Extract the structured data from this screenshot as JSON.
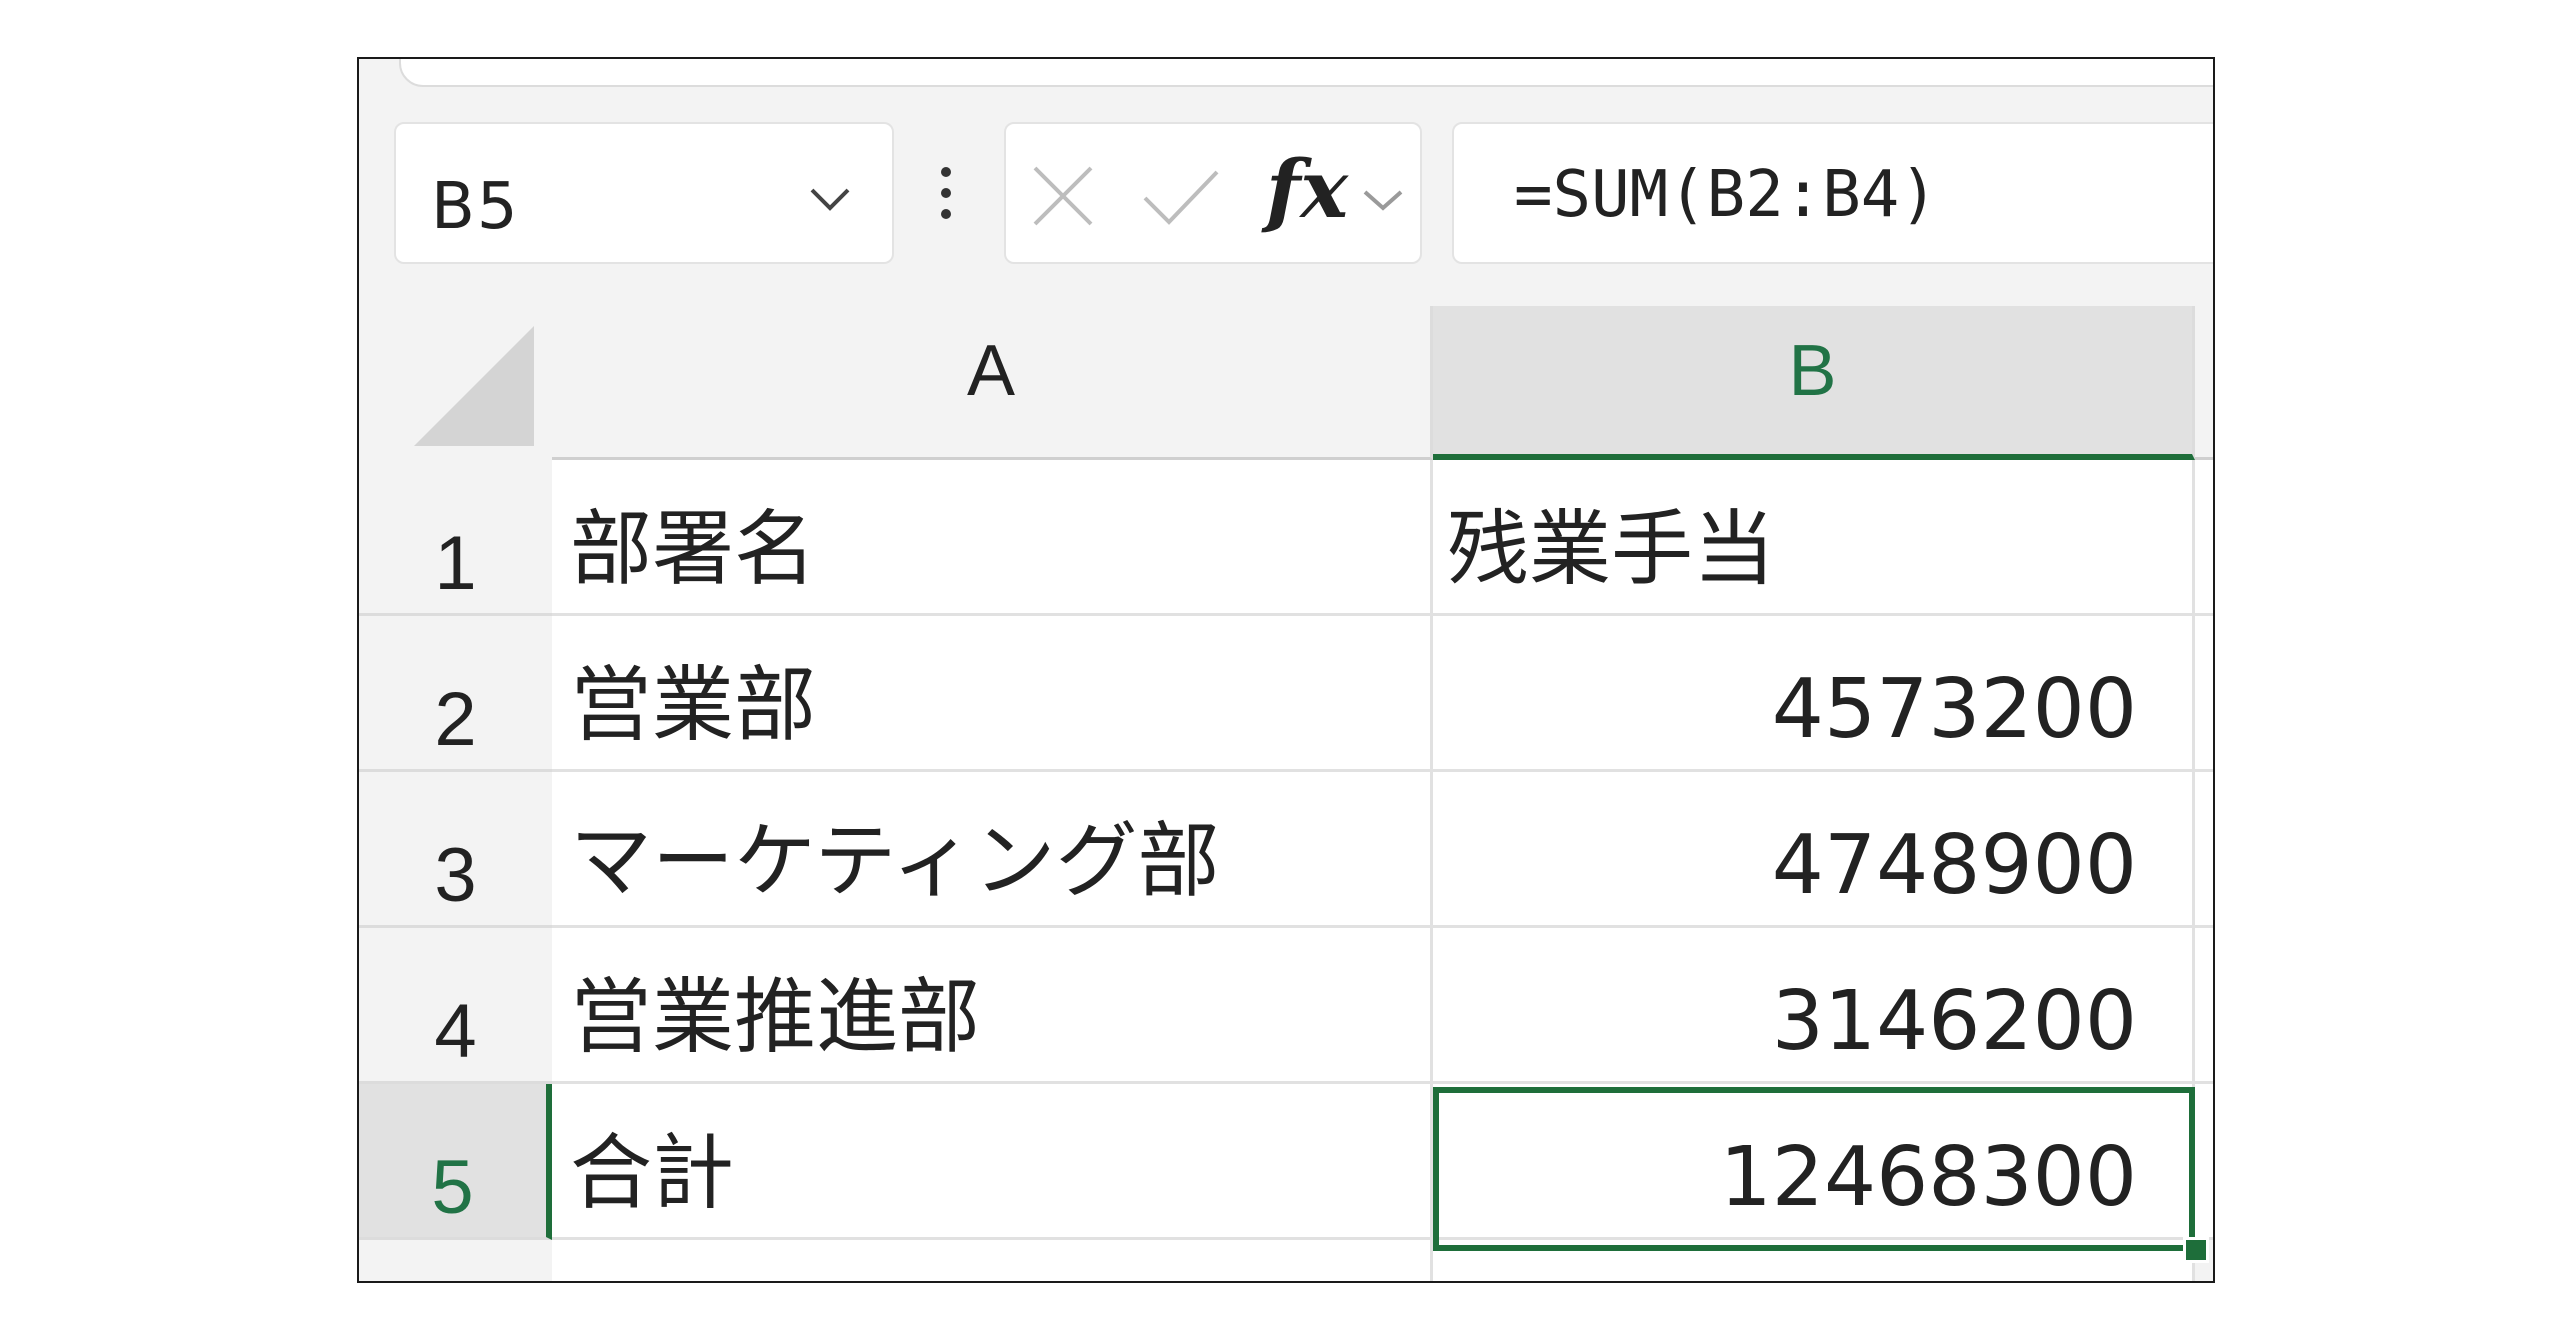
{
  "formula_bar": {
    "name_box": "B5",
    "formula": "=SUM(B2:B4)",
    "fx": "fx"
  },
  "columns": [
    "A",
    "B"
  ],
  "rows": [
    {
      "num": "1",
      "a": "部署名",
      "b": "残業手当"
    },
    {
      "num": "2",
      "a": "営業部",
      "b": "4573200"
    },
    {
      "num": "3",
      "a": "マーケティング部",
      "b": "4748900"
    },
    {
      "num": "4",
      "a": "営業推進部",
      "b": "3146200"
    },
    {
      "num": "5",
      "a": "合計",
      "b": "12468300"
    }
  ],
  "colors": {
    "selection": "#1e6e3a",
    "header_bg": "#f3f3f3",
    "header_selected_bg": "#e1e1e1",
    "header_selected_text": "#217346"
  },
  "icons": {
    "name_box": "chevron-down-icon",
    "more": "vertical-dots-icon",
    "cancel": "close-icon",
    "enter": "checkmark-icon",
    "insert_function": "fx-icon",
    "fx_dropdown": "chevron-down-icon",
    "corner": "select-all-triangle-icon"
  }
}
